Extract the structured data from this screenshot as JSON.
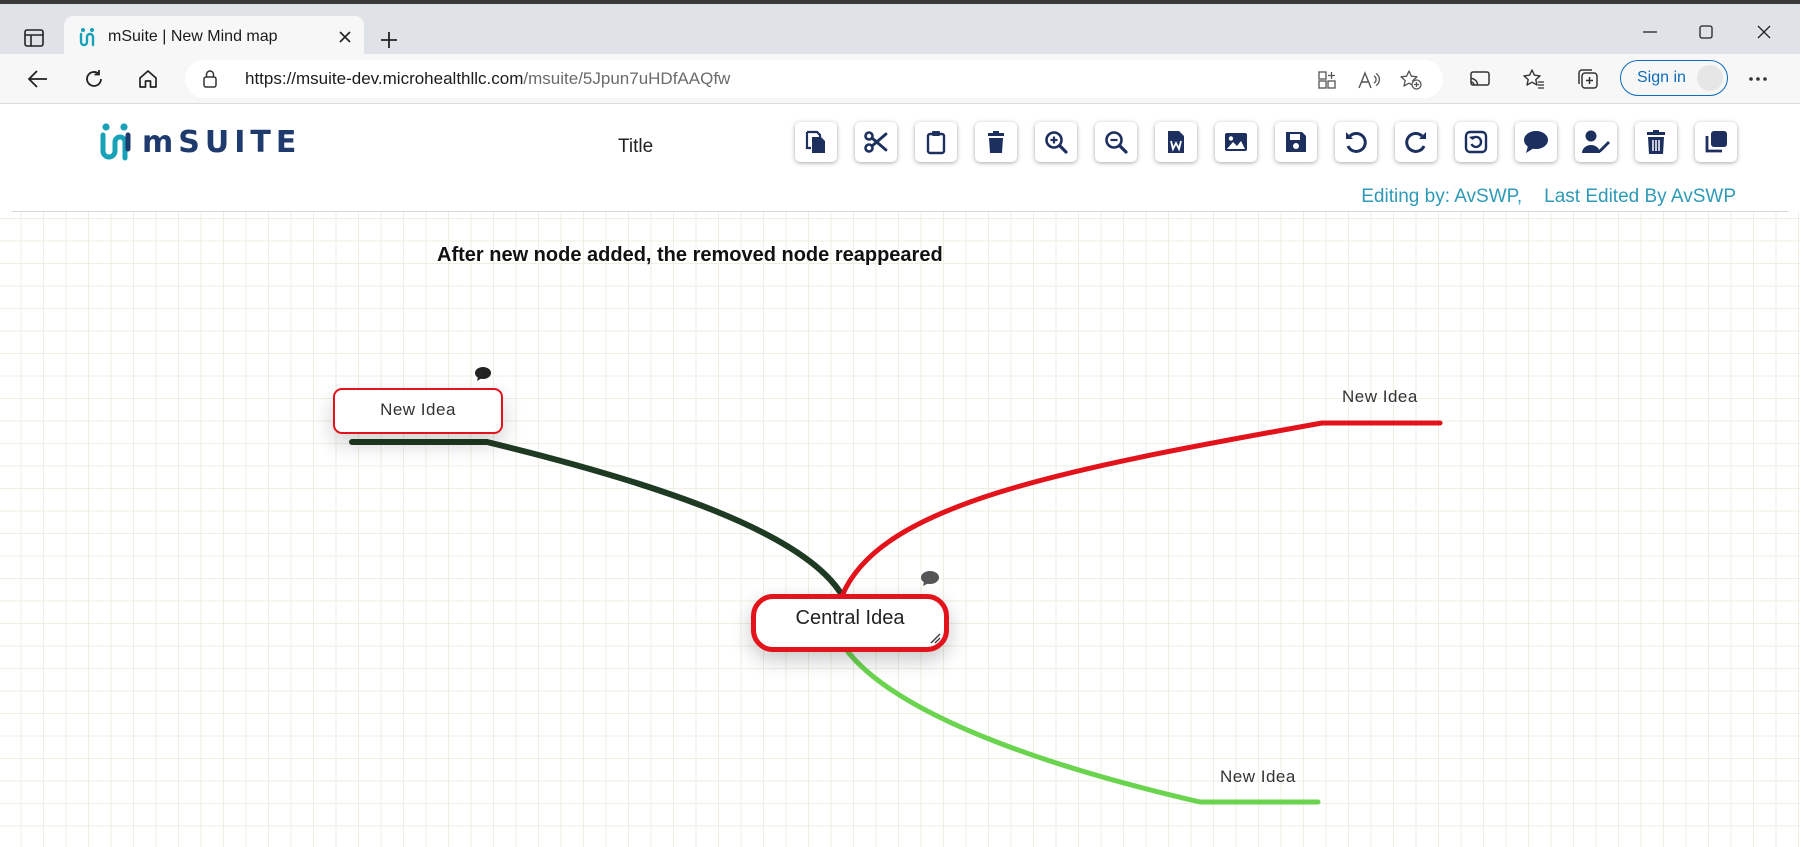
{
  "browser": {
    "tab_title": "mSuite | New Mind map",
    "url_host": "https://msuite-dev.microhealthllc.com",
    "url_path": "/msuite/5Jpun7uHDfAAQfw",
    "signin_label": "Sign in"
  },
  "app": {
    "logo_text": "mSUITE",
    "doc_title": "Title",
    "toolbar": [
      "copy-icon",
      "cut-icon",
      "paste-icon",
      "delete-icon",
      "zoom-in-icon",
      "zoom-out-icon",
      "word-export-icon",
      "image-export-icon",
      "save-icon",
      "undo-icon",
      "redo-icon",
      "reset-icon",
      "comment-icon",
      "edit-user-icon",
      "trash-icon",
      "duplicate-icon"
    ],
    "editing_by": "Editing by: AvSWP,",
    "last_edited": "Last Edited By AvSWP"
  },
  "canvas": {
    "note": "After new node added, the removed node reappeared",
    "central": "Central Idea",
    "node_left": "New Idea",
    "node_right_top": "New Idea",
    "node_right_bottom": "New Idea",
    "colors": {
      "left_branch": "#1f3a22",
      "right_top_branch": "#e3131b",
      "right_bottom_branch": "#6bd44f",
      "node_border": "#e3131b"
    }
  }
}
